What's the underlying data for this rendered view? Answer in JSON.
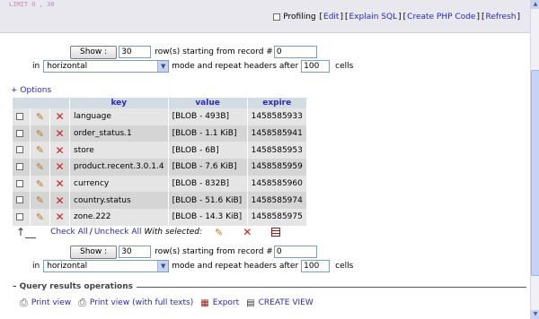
{
  "sql_fragment": "LIMIT 0 , 30",
  "profiling": {
    "label": "Profiling",
    "links": [
      "Edit",
      "Explain SQL",
      "Create PHP Code",
      "Refresh"
    ]
  },
  "nav_top": {
    "show_label": "Show :",
    "rows_value": "30",
    "text_rows": "row(s) starting from record #",
    "start_value": "0",
    "in_label": "in",
    "mode_value": "horizontal",
    "text_mode": "mode and repeat headers after",
    "repeat_value": "100",
    "cells_label": "cells"
  },
  "options_link": "+ Options",
  "table": {
    "headers": [
      "key",
      "value",
      "expire"
    ],
    "rows": [
      {
        "key": "language",
        "value": "[BLOB - 493B]",
        "expire": "1458585933"
      },
      {
        "key": "order_status.1",
        "value": "[BLOB - 1.1  KiB]",
        "expire": "1458585941"
      },
      {
        "key": "store",
        "value": "[BLOB - 6B]",
        "expire": "1458585953"
      },
      {
        "key": "product.recent.3.0.1.4",
        "value": "[BLOB - 7.6  KiB]",
        "expire": "1458585959"
      },
      {
        "key": "currency",
        "value": "[BLOB - 832B]",
        "expire": "1458585960"
      },
      {
        "key": "country.status",
        "value": "[BLOB - 51.6  KiB]",
        "expire": "1458585974"
      },
      {
        "key": "zone.222",
        "value": "[BLOB - 14.3  KiB]",
        "expire": "1458585975"
      }
    ]
  },
  "bottom": {
    "check_all": "Check All",
    "slash": "/",
    "uncheck_all": "Uncheck All",
    "with_selected": "With selected:"
  },
  "nav_bottom": {
    "show_label": "Show :",
    "rows_value": "30",
    "text_rows": "row(s) starting from record #",
    "start_value": "0",
    "in_label": "in",
    "mode_value": "horizontal",
    "text_mode": "mode and repeat headers after",
    "repeat_value": "100",
    "cells_label": "cells"
  },
  "query_ops": {
    "legend": "Query results operations",
    "print_view": "Print view",
    "print_view_full": "Print view (with full texts)",
    "export": "Export",
    "create_view": "CREATE VIEW"
  },
  "colors": {
    "link": "#2a2ab8",
    "header_bg": "#d3dce3",
    "row_light": "#e5e5e5",
    "row_dark": "#d5d5d5",
    "delete_red": "#d21e1e"
  },
  "icons": [
    "pencil-icon",
    "delete-icon",
    "printer-icon",
    "export-icon",
    "create-view-icon",
    "arrow-up-icon",
    "table-icon"
  ]
}
